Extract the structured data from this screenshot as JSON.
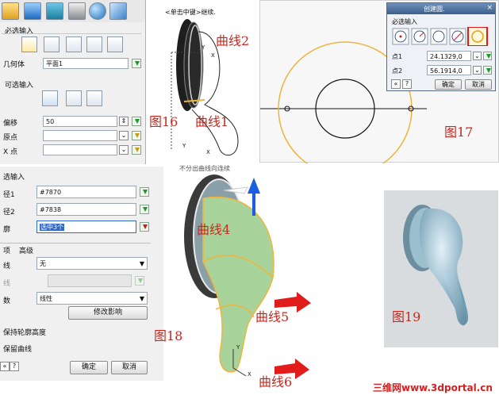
{
  "figure16": {
    "panel": {
      "section_required": "必选输入",
      "geometry_label": "几何体",
      "geometry_value": "平面1",
      "section_optional": "可选输入",
      "offset_label": "偏移",
      "offset_value": "50",
      "origin_label": "原点",
      "x_point_label": "X 点"
    },
    "viewport_hint": "<单击中键>继续.",
    "curve_labels": [
      "曲线2",
      "曲线1"
    ],
    "axis_labels": [
      "Y",
      "X",
      "Y",
      "X"
    ],
    "caption": "图16"
  },
  "figure17": {
    "dialog": {
      "title": "创建圆.",
      "section": "必选输入",
      "point1_label": "点1",
      "point1_value": "24.1329,0",
      "point2_label": "点2",
      "point2_value": "56.1914,0",
      "ok": "确定",
      "cancel": "取消"
    },
    "caption": "图17"
  },
  "figure18": {
    "panel": {
      "section": "选输入",
      "path1_label": "径1",
      "path1_value": "#7870",
      "path2_label": "径2",
      "path2_value": "#7838",
      "profile_label": "廓",
      "profile_value": "选中3个",
      "tab_options": "项",
      "tab_advanced": "高级",
      "row1_label": "线",
      "row1_value": "无",
      "row2_label": "线",
      "row3_label": "数",
      "row3_value": "线性",
      "modify_button": "修改影响",
      "keep_profile_height": "保持轮廓高度",
      "keep_curves": "保留曲线",
      "ok": "确定",
      "cancel": "取消"
    },
    "top_text": "不分出曲线向连续",
    "curve_labels": [
      "曲线4",
      "曲线5",
      "曲线6"
    ],
    "axis_labels": [
      "Y",
      "X"
    ],
    "caption": "图18"
  },
  "figure19": {
    "caption": "图19"
  },
  "watermark": "三维网www.3dportal.cn",
  "colors": {
    "caption_red": "#c8281e",
    "highlight_orange": "#f0b43c",
    "selection_blue": "#3169c6",
    "arrow_red": "#e21b1b",
    "arrow_blue": "#1b5ee2"
  }
}
